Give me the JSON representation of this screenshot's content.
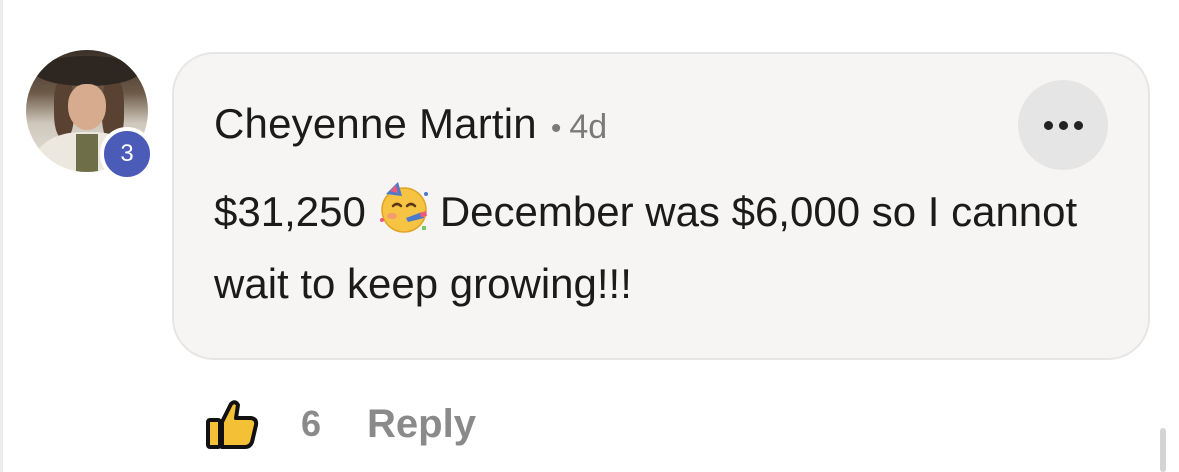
{
  "comment": {
    "author": "Cheyenne Martin",
    "separator": "•",
    "timestamp": "4d",
    "text_before_emoji": "$31,250",
    "emoji_name": "partying-face",
    "text_after_emoji": "December was $6,000 so I cannot wait to keep growing!!!",
    "avatar_badge_count": "3",
    "more_icon": "ellipsis-horizontal-icon"
  },
  "actions": {
    "like_icon": "thumbs-up-icon",
    "like_count": "6",
    "reply_label": "Reply"
  },
  "colors": {
    "bubble_bg": "#f6f5f3",
    "badge": "#4a5bb8",
    "muted_text": "#8a8a8a"
  }
}
